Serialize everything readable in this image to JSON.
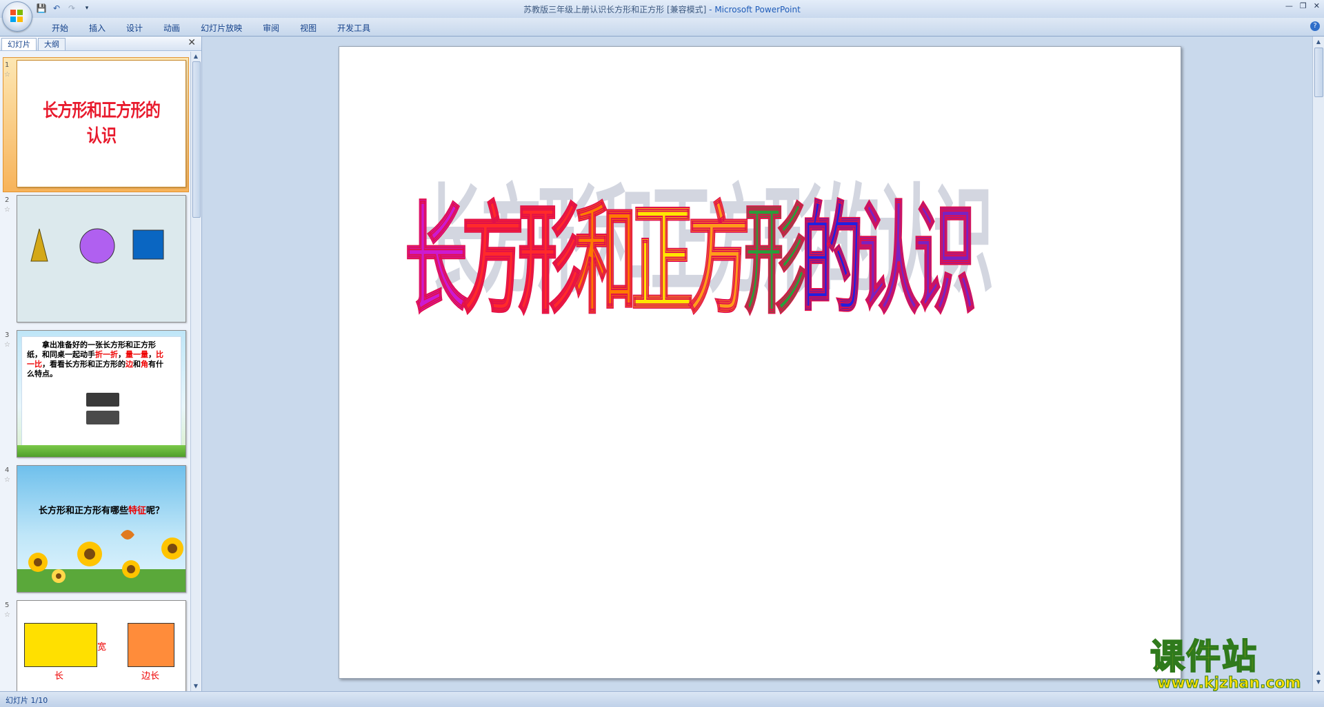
{
  "window": {
    "title": "苏教版三年级上册认识长方形和正方形 [兼容模式]",
    "app_suffix": " - Microsoft PowerPoint"
  },
  "ribbon": {
    "tabs": [
      "开始",
      "插入",
      "设计",
      "动画",
      "幻灯片放映",
      "审阅",
      "视图",
      "开发工具"
    ]
  },
  "pane": {
    "tab_slides": "幻灯片",
    "tab_outline": "大纲",
    "thumbnails": [
      {
        "number": "1",
        "title": "长方形和正方形的认识"
      },
      {
        "number": "2"
      },
      {
        "number": "3",
        "text_part1": "拿出准备好的一张长方形和正方形纸，和同桌一起动手",
        "highlight1": "折一折",
        "sep1": "，",
        "highlight2": "量一量",
        "sep2": "，",
        "highlight3": "比一比",
        "text_part2": "，看看长方形和正方形的",
        "highlight4": "边",
        "text_and": "和",
        "highlight5": "角",
        "text_part3": "有什么特点。"
      },
      {
        "number": "4",
        "q_text": "长方形和正方形有哪些",
        "q_highlight": "特征",
        "q_end": "呢？"
      },
      {
        "number": "5",
        "label_width": "宽",
        "label_length": "长",
        "label_side": "边长"
      }
    ]
  },
  "slide": {
    "title": "长方形和正方形的认识",
    "title_colors": [
      "#cc1ad0",
      "#ff2a2a",
      "#ff2a2a",
      "#ff7a00",
      "#ffe600",
      "#ff9c1a",
      "#2a9d3a",
      "#2020e0",
      "#7a22c0",
      "#7a22c0"
    ]
  },
  "status": {
    "slide_indicator": "幻灯片 1/10"
  },
  "watermark": {
    "cn": "课件站",
    "url": "www.kjzhan.com"
  }
}
